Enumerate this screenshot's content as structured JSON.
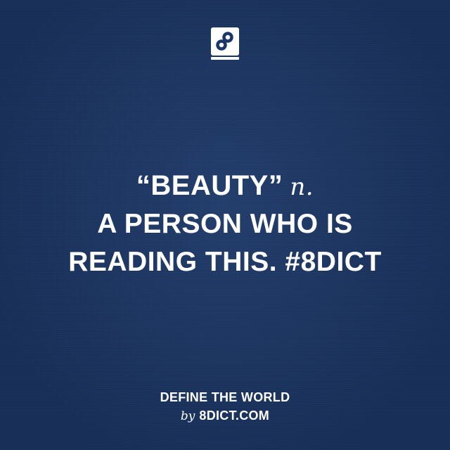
{
  "logo": {
    "icon": "8dict-book-icon",
    "glyph": "8"
  },
  "entry": {
    "headword": "“BEAUTY”",
    "part_of_speech": "n.",
    "definition_lines": [
      "A PERSON WHO IS",
      "READING THIS. #8DICT"
    ]
  },
  "footer": {
    "tagline": "DEFINE THE WORLD",
    "by": "by",
    "site": "8DICT.COM"
  },
  "colors": {
    "background": "#1b3768",
    "text": "#ffffff"
  }
}
